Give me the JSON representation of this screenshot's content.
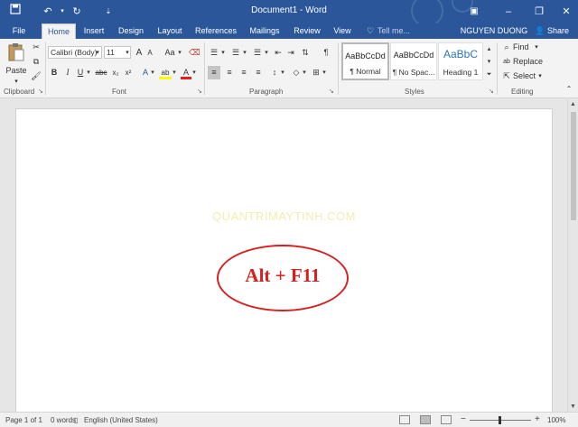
{
  "titlebar": {
    "title": "Document1 - Word",
    "tell_me": "Tell me...",
    "user": "NGUYEN DUONG",
    "share": "Share",
    "accent": "#2b579a"
  },
  "tabs": {
    "file": "File",
    "items": [
      "Home",
      "Insert",
      "Design",
      "Layout",
      "References",
      "Mailings",
      "Review",
      "View"
    ]
  },
  "ribbon": {
    "clipboard": {
      "paste": "Paste",
      "label": "Clipboard"
    },
    "font": {
      "family": "Calibri (Body)",
      "size": "11",
      "aa": "Aa",
      "bold": "B",
      "italic": "I",
      "underline": "U",
      "strike": "abc",
      "subscript": "x₂",
      "superscript": "x²",
      "label": "Font"
    },
    "paragraph": {
      "label": "Paragraph"
    },
    "styles": {
      "items": [
        {
          "sample": "AaBbCcDd",
          "name": "¶ Normal"
        },
        {
          "sample": "AaBbCcDd",
          "name": "¶ No Spac..."
        },
        {
          "sample": "AaBbC",
          "name": "Heading 1"
        }
      ],
      "label": "Styles"
    },
    "editing": {
      "find": "Find",
      "replace": "Replace",
      "select": "Select",
      "label": "Editing"
    }
  },
  "document": {
    "watermark": "QUANTRIMAYTINH.COM",
    "callout_text": "Alt + F11",
    "callout_color": "#d62020"
  },
  "statusbar": {
    "page": "Page 1 of 1",
    "words": "0 words",
    "language": "English (United States)",
    "zoom": "100%"
  }
}
